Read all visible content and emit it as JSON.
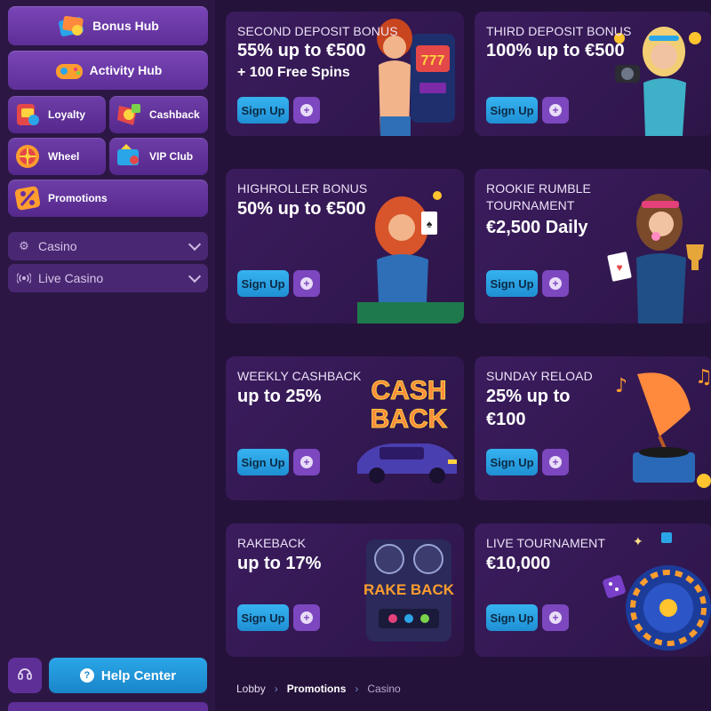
{
  "sidebar": {
    "bonus_hub": "Bonus Hub",
    "activity_hub": "Activity Hub",
    "tiles": [
      {
        "label": "Loyalty",
        "icon": "loyalty-icon"
      },
      {
        "label": "Cashback",
        "icon": "cashback-icon"
      },
      {
        "label": "Wheel",
        "icon": "wheel-icon"
      },
      {
        "label": "VIP Club",
        "icon": "vip-club-icon"
      },
      {
        "label": "Promotions",
        "icon": "promotions-icon"
      }
    ],
    "dropdowns": [
      {
        "label": "Casino",
        "icon": "gear-icon"
      },
      {
        "label": "Live Casino",
        "icon": "broadcast-icon"
      }
    ],
    "help_center": "Help Center"
  },
  "cards": [
    {
      "kicker": "SECOND DEPOSIT BONUS",
      "headline": "55% up to €500",
      "subline": "+ 100 Free Spins",
      "cta": "Sign Up"
    },
    {
      "kicker": "THIRD DEPOSIT BONUS",
      "headline": "100% up to €500",
      "subline": "",
      "cta": "Sign Up"
    },
    {
      "kicker": "HIGHROLLER BONUS",
      "headline": "50% up to €500",
      "subline": "",
      "cta": "Sign Up"
    },
    {
      "kicker": "ROOKIE RUMBLE",
      "kicker2": "TOURNAMENT",
      "headline": "€2,500 Daily",
      "subline": "",
      "cta": "Sign Up"
    },
    {
      "kicker": "WEEKLY CASHBACK",
      "headline": "up to 25%",
      "subline": "",
      "cta": "Sign Up",
      "art_text1": "CASH",
      "art_text2": "BACK"
    },
    {
      "kicker": "SUNDAY RELOAD",
      "headline": "25% up to",
      "headline2": "€100",
      "subline": "",
      "cta": "Sign Up"
    },
    {
      "kicker": "RAKEBACK",
      "headline": "up to 17%",
      "subline": "",
      "cta": "Sign Up",
      "art_text1": "RAKE BACK"
    },
    {
      "kicker": "LIVE TOURNAMENT",
      "headline": "€10,000",
      "subline": "",
      "cta": "Sign Up"
    }
  ],
  "breadcrumb": [
    "Lobby",
    "Promotions",
    "Casino"
  ],
  "colors": {
    "sidebar_bg": "#2c1744",
    "main_bg": "#24123a",
    "card_bg": "#3b1c5e",
    "signup_blue": "#1f8fd4",
    "plus_purple": "#7c47bf",
    "help_blue": "#1a85c9"
  }
}
